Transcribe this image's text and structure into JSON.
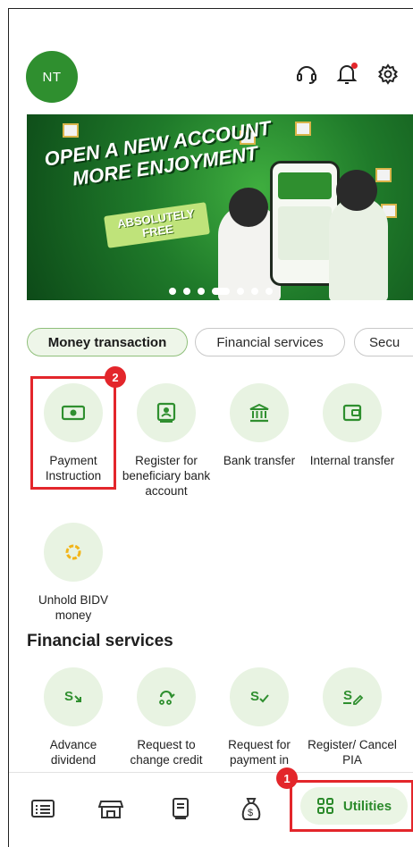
{
  "header": {
    "avatar_initials": "NT",
    "icons": [
      "support-icon",
      "bell-icon",
      "gear-icon"
    ]
  },
  "banner": {
    "headline_line1": "OPEN A NEW ACCOUNT",
    "headline_line2": "MORE ENJOYMENT",
    "ribbon_line1": "ABSOLUTELY",
    "ribbon_line2": "FREE",
    "slide_count": 7,
    "active_slide": 4
  },
  "tabs": [
    {
      "label": "Money transaction",
      "active": true
    },
    {
      "label": "Financial services",
      "active": false
    },
    {
      "label": "Secu",
      "active": false
    }
  ],
  "money_transaction": {
    "items": [
      {
        "label": "Payment Instruction",
        "icon": "banknote-icon"
      },
      {
        "label": "Register for beneficiary bank account",
        "icon": "account-card-icon"
      },
      {
        "label": "Bank transfer",
        "icon": "bank-icon"
      },
      {
        "label": "Internal transfer",
        "icon": "wallet-icon"
      },
      {
        "label": "Unhold BIDV money",
        "icon": "unhold-coin-icon"
      }
    ]
  },
  "financial_services": {
    "title": "Financial services",
    "items": [
      {
        "label": "Advance dividend",
        "icon": "dividend-icon"
      },
      {
        "label": "Request to change credit",
        "icon": "change-credit-icon"
      },
      {
        "label": "Request for payment in",
        "icon": "payment-request-icon"
      },
      {
        "label": "Register/ Cancel PIA",
        "icon": "register-pia-icon"
      }
    ]
  },
  "annotations": {
    "badge_1": "1",
    "badge_2": "2"
  },
  "bottom_nav": {
    "items": [
      "list-icon",
      "store-icon",
      "book-icon",
      "money-bag-icon"
    ],
    "utilities_label": "Utilities"
  },
  "colors": {
    "brand_green": "#2f8f2f",
    "light_green": "#e8f3e2",
    "highlight_red": "#e3262b"
  }
}
